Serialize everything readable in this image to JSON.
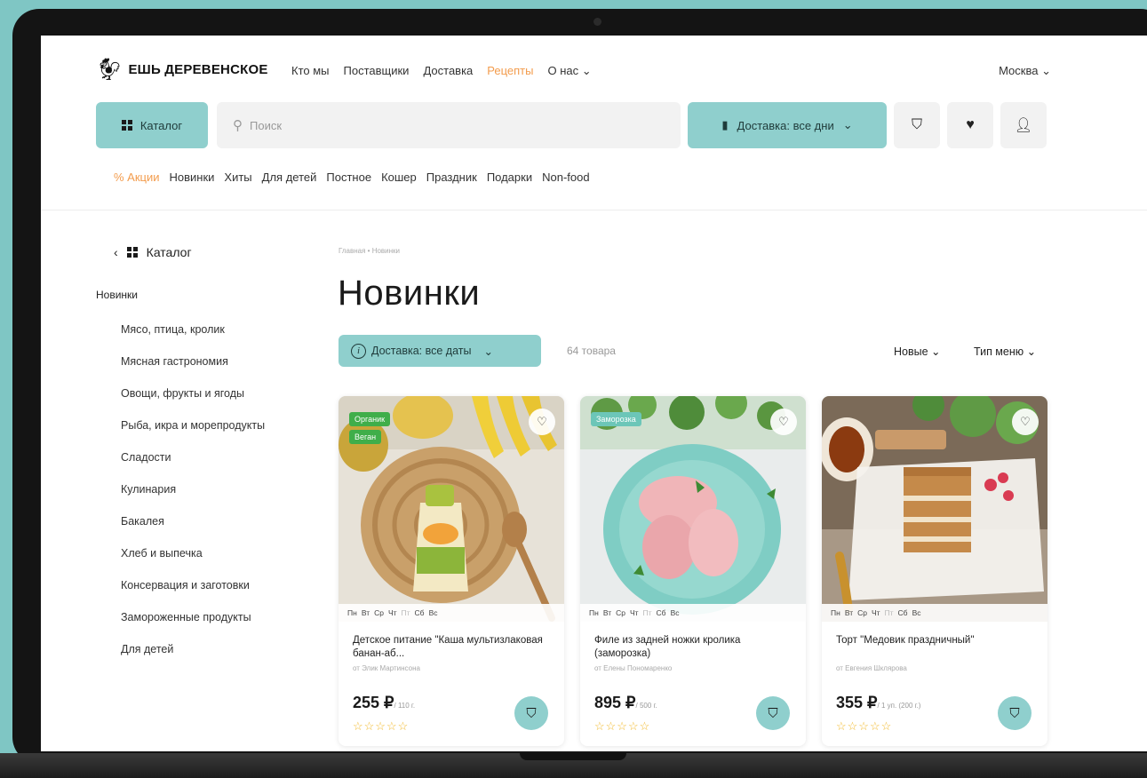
{
  "header": {
    "logo_text": "ЕШЬ ДЕРЕВЕНСКОЕ",
    "nav": [
      "Кто мы",
      "Поставщики",
      "Доставка",
      "Рецепты",
      "О нас"
    ],
    "nav_active": "Рецепты",
    "city": "Москва"
  },
  "toolbar": {
    "catalog_label": "Каталог",
    "search_placeholder": "Поиск",
    "delivery_label": "Доставка: все дни"
  },
  "category_nav": [
    "% Акции",
    "Новинки",
    "Хиты",
    "Для детей",
    "Постное",
    "Кошер",
    "Праздник",
    "Подарки",
    "Non-food"
  ],
  "sidebar": {
    "head_label": "Каталог",
    "title": "Новинки",
    "items": [
      "Мясо, птица, кролик",
      "Мясная гастрономия",
      "Овощи, фрукты и ягоды",
      "Рыба, икра и морепродукты",
      "Сладости",
      "Кулинария",
      "Бакалея",
      "Хлеб и выпечка",
      "Консервация и заготовки",
      "Замороженные продукты",
      "Для детей"
    ]
  },
  "main": {
    "breadcrumb": "Главная • Новинки",
    "title": "Новинки",
    "filter_label": "Доставка: все даты",
    "count": "64 товара",
    "sort_label": "Новые",
    "menu_type_label": "Тип меню"
  },
  "products": [
    {
      "badges": [
        "Органик",
        "Веган"
      ],
      "days": [
        "Пн",
        "Вт",
        "Ср",
        "Чт",
        "Пт",
        "Сб",
        "Вс"
      ],
      "name": "Детское питание \"Каша мультизлаковая банан-аб...",
      "vendor": "от Элик Мартинсона",
      "price": "255 ₽",
      "unit": "/ 110 г.",
      "rating": 5
    },
    {
      "badges": [
        "Заморозка"
      ],
      "days": [
        "Пн",
        "Вт",
        "Ср",
        "Чт",
        "Пт",
        "Сб",
        "Вс"
      ],
      "name": "Филе из задней ножки кролика (заморозка)",
      "vendor": "от Елены Пономаренко",
      "price": "895 ₽",
      "unit": "/ 500 г.",
      "rating": 5
    },
    {
      "badges": [],
      "days": [
        "Пн",
        "Вт",
        "Ср",
        "Чт",
        "Пт",
        "Сб",
        "Вс"
      ],
      "name": "Торт \"Медовик праздничный\"",
      "vendor": "от Евгения Шклярова",
      "price": "355 ₽",
      "unit": "/ 1 уп. (200 г.)",
      "rating": 5
    }
  ],
  "colors": {
    "accent": "#8fcfcd",
    "highlight": "#f39c4d",
    "badge_green": "#3fae4a",
    "badge_teal": "#6cc6b8",
    "star": "#f2b92b",
    "background": "#7fc6c4"
  },
  "icons": [
    "catalog-grid-icon",
    "search-icon",
    "delivery-box-icon",
    "basket-icon",
    "heart-icon",
    "user-icon",
    "chevron-down-icon",
    "back-arrow-icon",
    "info-icon",
    "favorite-icon",
    "star-icon",
    "add-to-cart-icon"
  ]
}
